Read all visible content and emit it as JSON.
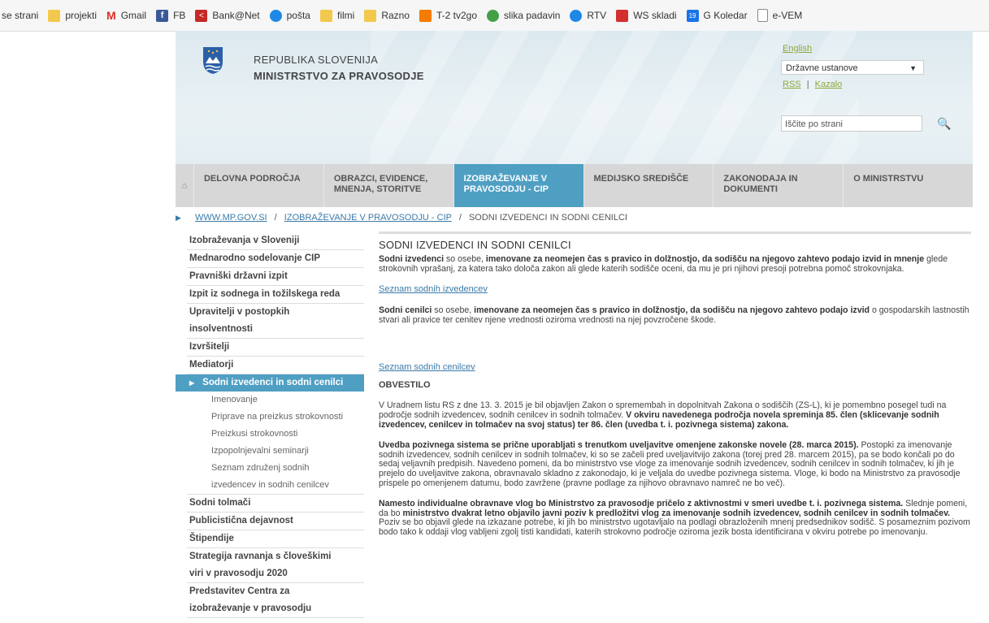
{
  "bookmarks": [
    {
      "label": "se strani",
      "icon": "none",
      "color": ""
    },
    {
      "label": "projekti",
      "icon": "folder-icon",
      "color": "#f2c94c"
    },
    {
      "label": "Gmail",
      "icon": "gmail-icon",
      "color": "#d93025"
    },
    {
      "label": "FB",
      "icon": "facebook-icon",
      "color": "#3b5998"
    },
    {
      "label": "Bank@Net",
      "icon": "bank-icon",
      "color": "#c62828"
    },
    {
      "label": "pošta",
      "icon": "mail-icon",
      "color": "#1e88e5"
    },
    {
      "label": "filmi",
      "icon": "folder-icon",
      "color": "#f2c94c"
    },
    {
      "label": "Razno",
      "icon": "folder-icon",
      "color": "#f2c94c"
    },
    {
      "label": "T-2 tv2go",
      "icon": "tv-icon",
      "color": "#f57c00"
    },
    {
      "label": "slika padavin",
      "icon": "weather-icon",
      "color": "#43a047"
    },
    {
      "label": "RTV",
      "icon": "rtv-icon",
      "color": "#1e88e5"
    },
    {
      "label": "WS skladi",
      "icon": "chart-icon",
      "color": "#d32f2f"
    },
    {
      "label": "G Koledar",
      "icon": "calendar-icon",
      "color": "#1a73e8"
    },
    {
      "label": "e-VEM",
      "icon": "document-icon",
      "color": "#888888"
    }
  ],
  "header": {
    "republic": "REPUBLIKA SLOVENIJA",
    "ministry": "MINISTRSTVO ZA PRAVOSODJE",
    "language_link": "English",
    "institutions_select": "Državne ustanove",
    "rss": "RSS",
    "separator": "|",
    "index": "Kazalo",
    "search_placeholder": "Iščite po strani"
  },
  "nav": [
    {
      "label": "DELOVNA PODROČJA",
      "width": 0
    },
    {
      "label": "OBRAZCI, EVIDENCE, MNENJA, STORITVE"
    },
    {
      "label": "IZOBRAŽEVANJE V PRAVOSODJU - CIP",
      "active": true
    },
    {
      "label": "MEDIJSKO SREDIŠČE"
    },
    {
      "label": "ZAKONODAJA IN DOKUMENTI"
    },
    {
      "label": "O MINISTRSTVU"
    }
  ],
  "breadcrumb": {
    "home": "WWW.MP.GOV.SI",
    "section": "IZOBRAŽEVANJE V PRAVOSODJU - CIP",
    "current": "SODNI IZVEDENCI IN SODNI CENILCI",
    "sep": "/"
  },
  "sidebar": {
    "items_before": [
      "Izobraževanja v Sloveniji",
      "Mednarodno sodelovanje CIP",
      "Pravniški državni izpit",
      "Izpit iz sodnega in tožilskega reda"
    ],
    "insolvency_line1": "Upravitelji v postopkih",
    "insolvency_line2": "insolventnosti",
    "items_mid": [
      "Izvršitelji",
      "Mediatorji"
    ],
    "active": "Sodni izvedenci in sodni cenilci",
    "subs": [
      "Imenovanje",
      "Priprave na preizkus strokovnosti",
      "Preizkusi strokovnosti",
      "Izpopolnjevalni seminarji",
      "Seznam združenj sodnih",
      "izvedencev in sodnih cenilcev"
    ],
    "items_after": [
      "Sodni tolmači",
      "Publicistična dejavnost",
      "Štipendije"
    ],
    "strategy_line1": "Strategija ravnanja s človeškimi",
    "strategy_line2": "viri v pravosodju 2020",
    "center_line1": "Predstavitev Centra za",
    "center_line2": "izobraževanje v pravosodju"
  },
  "main": {
    "title": "SODNI IZVEDENCI IN SODNI CENILCI",
    "p1_b1": "Sodni izvedenci",
    "p1_t1": " so osebe, ",
    "p1_b2": "imenovane za neomejen čas s pravico in dolžnostjo, da sodišču na njegovo zahtevo podajo izvid in mnenje",
    "p1_t2": " glede strokovnih vprašanj, za katera tako določa zakon ali glede katerih sodišče oceni, da mu je pri njihovi presoji potrebna pomoč strokovnjaka.",
    "link1": "Seznam sodnih izvedencev",
    "p2_b1": "Sodni cenilci",
    "p2_t1": " so osebe, ",
    "p2_b2": "imenovane za neomejen čas s pravico in dolžnostjo, da sodišču na njegovo zahtevo podajo izvid",
    "p2_t2": " o gospodarskih lastnostih stvari ali pravice ter cenitev njene vrednosti oziroma vrednosti na njej povzročene škode.",
    "link2": "Seznam sodnih cenilcev",
    "notice": "OBVESTILO",
    "p3_t1": "V Uradnem listu RS z dne 13. 3. 2015 je bil objavljen Zakon o spremembah in dopolnitvah Zakona o sodiščih (ZS-L), ki je pomembno posegel tudi na področje sodnih izvedencev, sodnih cenilcev in sodnih tolmačev. ",
    "p3_b1": "V okviru navedenega področja novela spreminja 85. člen (sklicevanje sodnih izvedencev, cenilcev in tolmačev na svoj status) ter 86. člen (uvedba t. i. pozivnega sistema) zakona.",
    "p4_b1": "Uvedba pozivnega sistema se prične uporabljati s trenutkom uveljavitve omenjene zakonske novele (28. marca 2015).",
    "p4_t1": " Postopki za imenovanje sodnih izvedencev, sodnih cenilcev in sodnih tolmačev, ki so se začeli pred uveljavitvijo zakona (torej pred 28. marcem 2015), pa se bodo končali po do sedaj veljavnih predpisih. Navedeno pomeni, da bo ministrstvo vse vloge za imenovanje sodnih izvedencev, sodnih cenilcev in sodnih tolmačev, ki jih je prejelo do uveljavitve zakona, obravnavalo skladno z zakonodajo, ki je veljala do uvedbe pozivnega sistema. Vloge, ki bodo na Ministrstvo za pravosodje prispele po omenjenem datumu, bodo zavržene (pravne podlage za njihovo obravnavo namreč ne bo več).",
    "p5_b1": "Namesto individualne obravnave vlog bo Ministrstvo za pravosodje pričelo z aktivnostmi v smeri uvedbe t. i. pozivnega sistema.",
    "p5_t1": " Slednje pomeni, da bo ",
    "p5_b2": "ministrstvo dvakrat letno objavilo javni poziv k predložitvi vlog za imenovanje sodnih izvedencev, sodnih cenilcev in sodnih tolmačev.",
    "p5_t2": " Poziv se bo objavil glede na izkazane potrebe, ki jih bo ministrstvo ugotavljalo na podlagi obrazloženih mnenj predsednikov sodišč. S posameznim pozivom bodo tako k oddaji vlog vabljeni zgolj tisti kandidati, katerih strokovno področje oziroma jezik bosta identificirana v okviru potrebe po imenovanju."
  }
}
